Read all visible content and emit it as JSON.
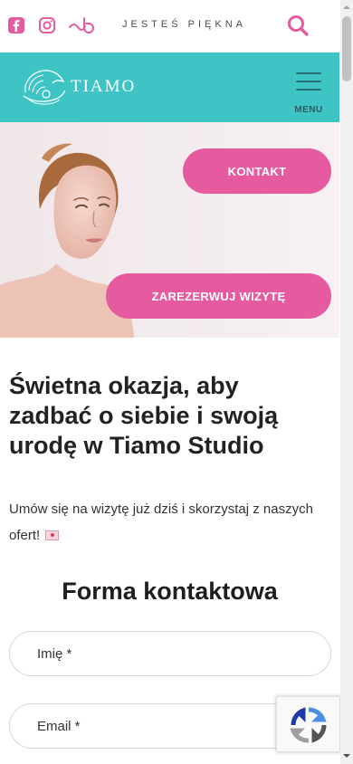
{
  "topbar": {
    "tagline": "JESTEŚ PIĘKNA",
    "icons": [
      "facebook-icon",
      "instagram-icon",
      "booksy-icon",
      "search-icon"
    ],
    "accent": "#e65aa0"
  },
  "header": {
    "logo_text": "TIAMO",
    "menu_label": "MENU",
    "background": "#3ec4c4"
  },
  "hero": {
    "contact_label": "KONTAKT",
    "book_label": "ZAREZERWUJ WIZYTĘ",
    "button_color": "#e65aa0"
  },
  "main": {
    "headline": "Świetna okazja, aby zadbać o siebie i swoją urodę w Tiamo Studio",
    "lead": "Umów się na wizytę już dziś i skorzystaj z naszych ofert!"
  },
  "form": {
    "title": "Forma kontaktowa",
    "name_placeholder": "Imię *",
    "email_placeholder": "Email *"
  }
}
